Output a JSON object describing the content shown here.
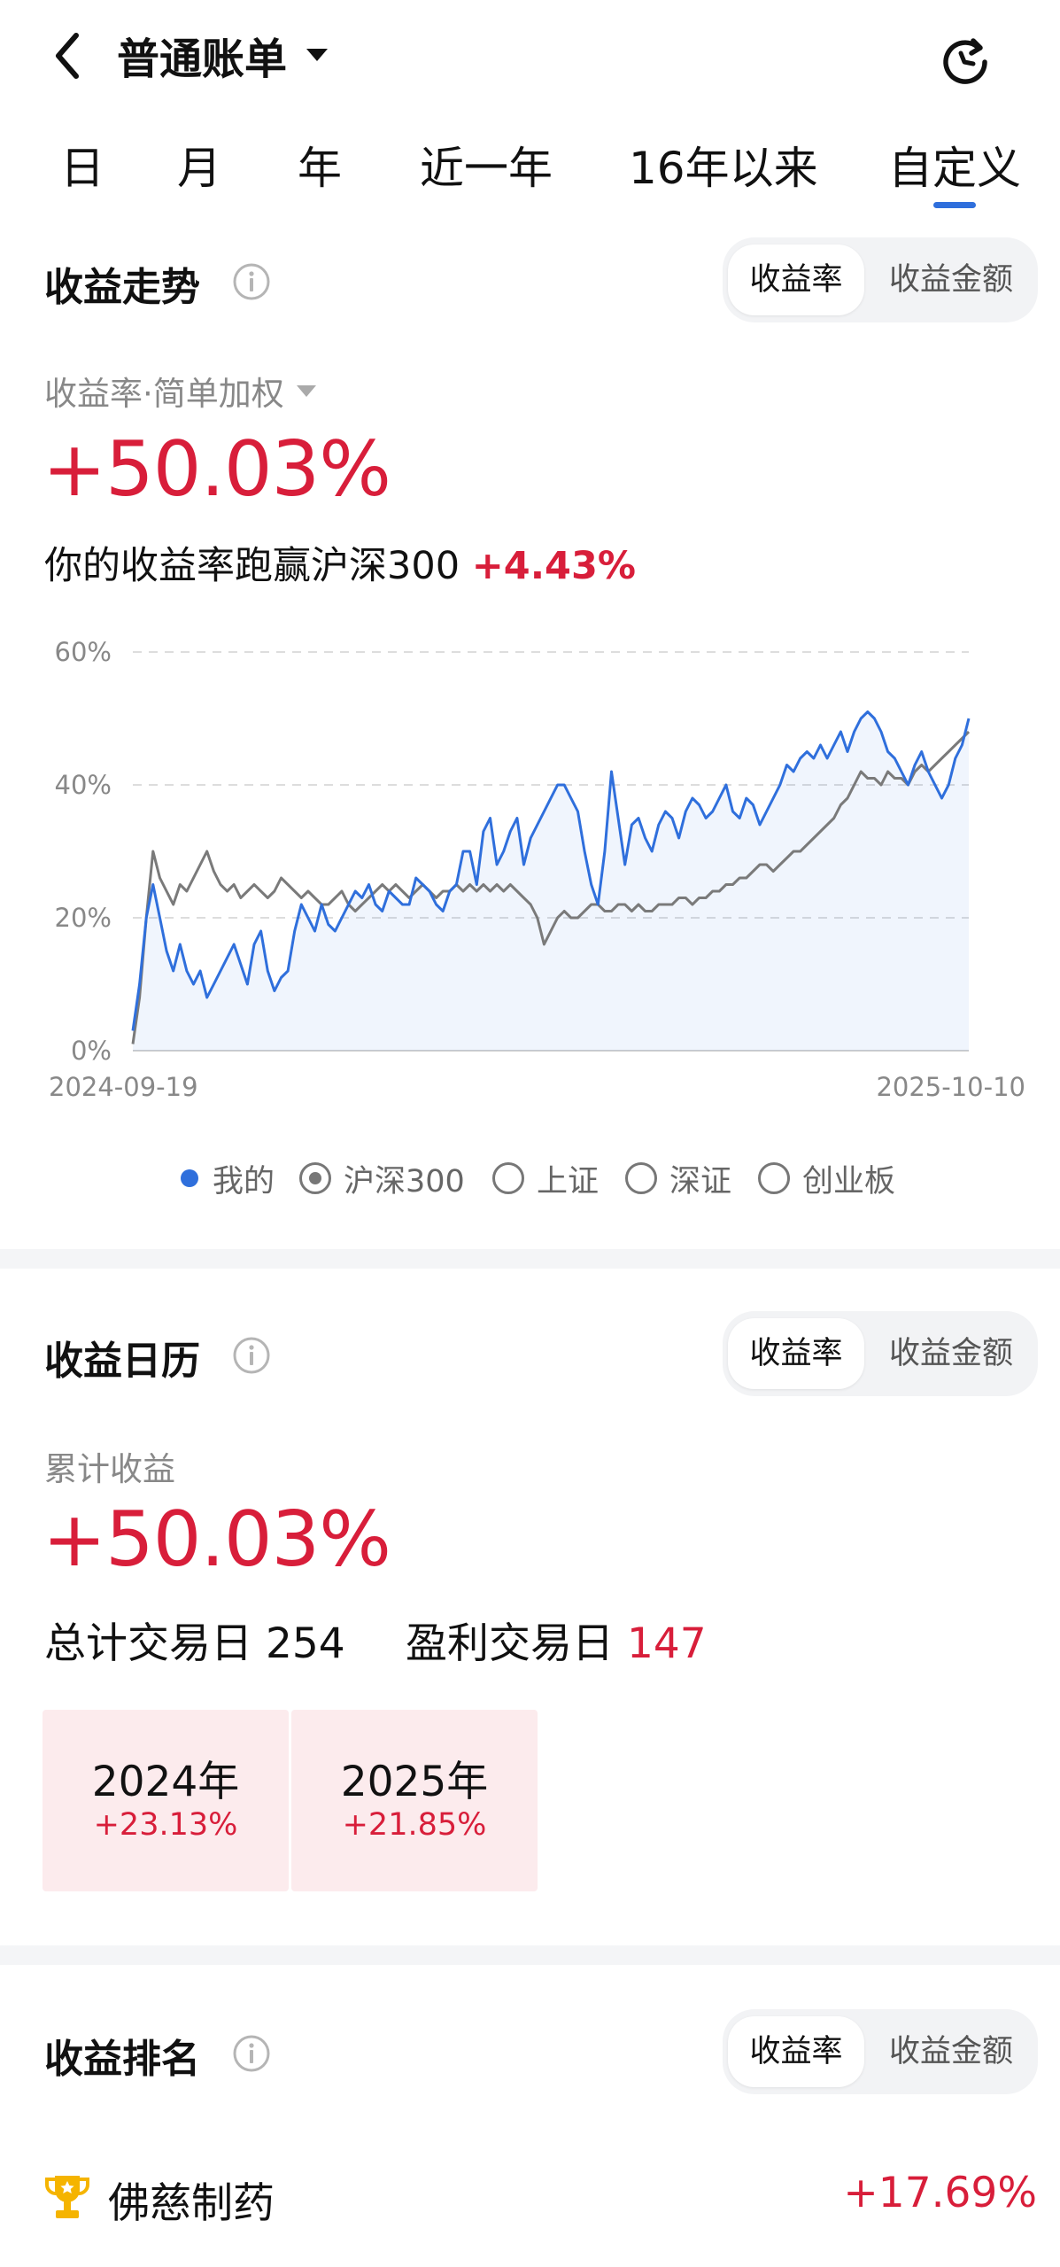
{
  "header": {
    "back_icon": "chevron-left-icon",
    "title": "普通账单",
    "refresh_icon": "refresh-icon"
  },
  "period_tabs": [
    {
      "label": "日",
      "active": false
    },
    {
      "label": "月",
      "active": false
    },
    {
      "label": "年",
      "active": false
    },
    {
      "label": "近一年",
      "active": false
    },
    {
      "label": "16年以来",
      "active": false
    },
    {
      "label": "自定义",
      "active": true
    }
  ],
  "trend": {
    "title": "收益走势",
    "toggle": {
      "rate": "收益率",
      "amount": "收益金额",
      "selected": "收益率"
    },
    "metric_label": "收益率·简单加权",
    "value": "+50.03%",
    "compare_text": "你的收益率跑赢沪深300",
    "compare_value": "+4.43%"
  },
  "chart_data": {
    "type": "line",
    "ylabel_ticks": [
      "60%",
      "40%",
      "20%",
      "0%"
    ],
    "ylim": [
      0,
      60
    ],
    "x_start_label": "2024-09-19",
    "x_end_label": "2025-10-10",
    "grid": true,
    "series": [
      {
        "name": "我的",
        "color": "#2f6fdc",
        "filled": true,
        "values": [
          3,
          10,
          20,
          25,
          20,
          15,
          12,
          16,
          12,
          10,
          12,
          8,
          10,
          12,
          14,
          16,
          13,
          10,
          16,
          18,
          12,
          9,
          11,
          12,
          18,
          22,
          20,
          18,
          22,
          19,
          18,
          20,
          22,
          24,
          23,
          25,
          22,
          21,
          24,
          23,
          22,
          22,
          26,
          25,
          24,
          22,
          21,
          24,
          25,
          30,
          30,
          25,
          33,
          35,
          28,
          30,
          33,
          35,
          28,
          32,
          34,
          36,
          38,
          40,
          40,
          38,
          36,
          30,
          25,
          22,
          30,
          42,
          35,
          28,
          34,
          35,
          32,
          30,
          34,
          36,
          35,
          32,
          36,
          38,
          37,
          35,
          36,
          38,
          40,
          36,
          35,
          38,
          37,
          34,
          36,
          38,
          40,
          43,
          42,
          44,
          45,
          44,
          46,
          44,
          46,
          48,
          45,
          48,
          50,
          51,
          50,
          48,
          45,
          44,
          42,
          40,
          43,
          45,
          42,
          40,
          38,
          40,
          44,
          46,
          50
        ]
      },
      {
        "name": "沪深300",
        "color": "#7a7a7a",
        "filled": false,
        "values": [
          1,
          8,
          20,
          30,
          26,
          24,
          22,
          25,
          24,
          26,
          28,
          30,
          27,
          25,
          24,
          25,
          23,
          24,
          25,
          24,
          23,
          24,
          26,
          25,
          24,
          23,
          24,
          23,
          22,
          22,
          23,
          24,
          22,
          21,
          22,
          23,
          24,
          25,
          24,
          25,
          24,
          23,
          24,
          25,
          24,
          23,
          24,
          24,
          25,
          24,
          25,
          24,
          25,
          24,
          25,
          24,
          25,
          24,
          23,
          22,
          20,
          16,
          18,
          20,
          21,
          20,
          20,
          21,
          22,
          22,
          21,
          21,
          22,
          22,
          21,
          22,
          21,
          21,
          22,
          22,
          22,
          23,
          23,
          22,
          23,
          23,
          24,
          24,
          25,
          25,
          26,
          26,
          27,
          28,
          28,
          27,
          28,
          29,
          30,
          30,
          31,
          32,
          33,
          34,
          35,
          37,
          38,
          40,
          42,
          41,
          41,
          40,
          42,
          41,
          41,
          40,
          42,
          43,
          42,
          43,
          44,
          45,
          46,
          47,
          48
        ]
      }
    ]
  },
  "legend": {
    "items": [
      {
        "label": "我的",
        "kind": "dot",
        "color": "#2f6fdc"
      },
      {
        "label": "沪深300",
        "kind": "radio",
        "checked": true
      },
      {
        "label": "上证",
        "kind": "radio",
        "checked": false
      },
      {
        "label": "深证",
        "kind": "radio",
        "checked": false
      },
      {
        "label": "创业板",
        "kind": "radio",
        "checked": false
      }
    ]
  },
  "calendar": {
    "title": "收益日历",
    "toggle": {
      "rate": "收益率",
      "amount": "收益金额"
    },
    "cum_label": "累计收益",
    "value": "+50.03%",
    "total_days_label": "总计交易日",
    "total_days": "254",
    "profit_days_label": "盈利交易日",
    "profit_days": "147",
    "years": [
      {
        "year": "2024年",
        "pct": "+23.13%"
      },
      {
        "year": "2025年",
        "pct": "+21.85%"
      }
    ]
  },
  "ranking": {
    "title": "收益排名",
    "toggle": {
      "rate": "收益率",
      "amount": "收益金额"
    },
    "items": [
      {
        "name": "佛慈制药",
        "value": "+17.69%",
        "icon": "trophy-icon"
      }
    ]
  },
  "colors": {
    "accent": "#2f6fdc",
    "gain": "#d81e3a",
    "card_bg": "#fcebed",
    "divider": "#f4f5f7"
  }
}
